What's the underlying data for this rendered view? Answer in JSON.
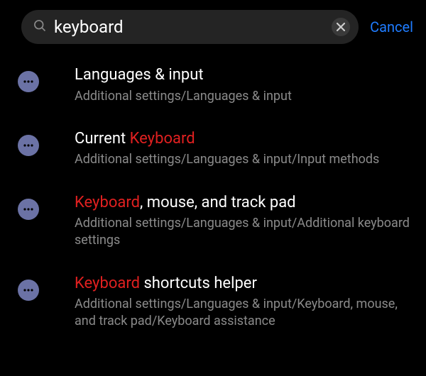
{
  "search": {
    "value": "keyboard",
    "highlight": "Keyboard",
    "cancel": "Cancel"
  },
  "results": [
    {
      "title_plain": "Languages & input",
      "title_highlight": "",
      "title_after": "",
      "path": "Additional settings/Languages & input"
    },
    {
      "title_plain": "Current ",
      "title_highlight": "Keyboard",
      "title_after": "",
      "path": "Additional settings/Languages & input/Input methods"
    },
    {
      "title_plain": "",
      "title_highlight": "Keyboard",
      "title_after": ", mouse, and track pad",
      "path": "Additional settings/Languages & input/Additional keyboard settings"
    },
    {
      "title_plain": "",
      "title_highlight": "Keyboard",
      "title_after": " shortcuts helper",
      "path": "Additional settings/Languages & input/Keyboard, mouse, and track pad/Keyboard assistance"
    }
  ]
}
